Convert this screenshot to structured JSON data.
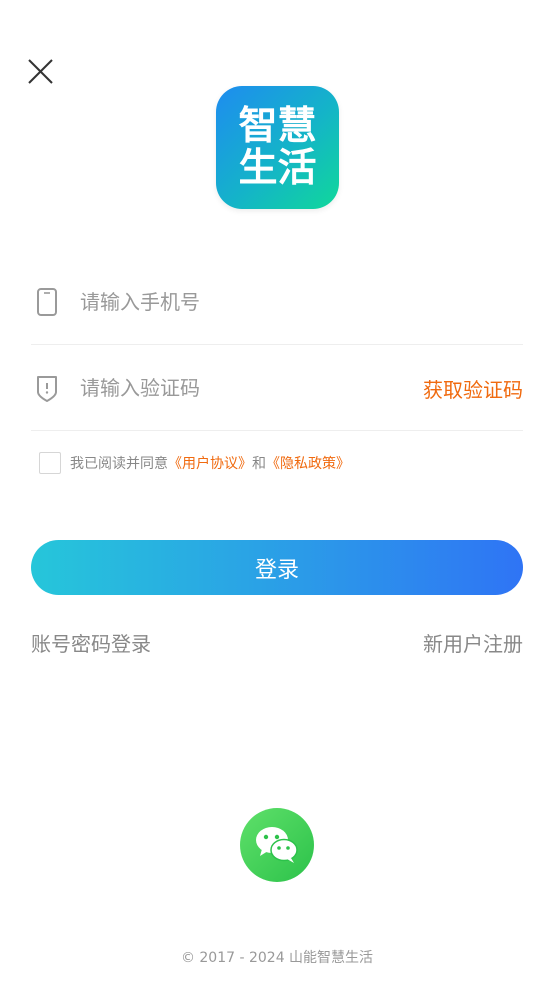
{
  "header": {
    "close_icon": "close-icon",
    "logo_line1": "智慧",
    "logo_line2": "生活"
  },
  "form": {
    "phone": {
      "placeholder": "请输入手机号",
      "value": "",
      "icon": "phone-icon"
    },
    "code": {
      "placeholder": "请输入验证码",
      "value": "",
      "icon": "shield-icon",
      "get_code_label": "获取验证码"
    }
  },
  "agreement": {
    "checked": false,
    "prefix": "我已阅读并同意",
    "user_agreement": "《用户协议》",
    "and": "和",
    "privacy_policy": "《隐私政策》"
  },
  "actions": {
    "login_label": "登录",
    "password_login": "账号密码登录",
    "register": "新用户注册",
    "wechat_icon": "wechat-icon"
  },
  "footer": {
    "copyright": "© 2017 - 2024 山能智慧生活"
  },
  "colors": {
    "accent_orange": "#f06a0f",
    "button_gradient_start": "#26c6da",
    "button_gradient_end": "#2f74f5",
    "wechat_green": "#2cc24a"
  }
}
